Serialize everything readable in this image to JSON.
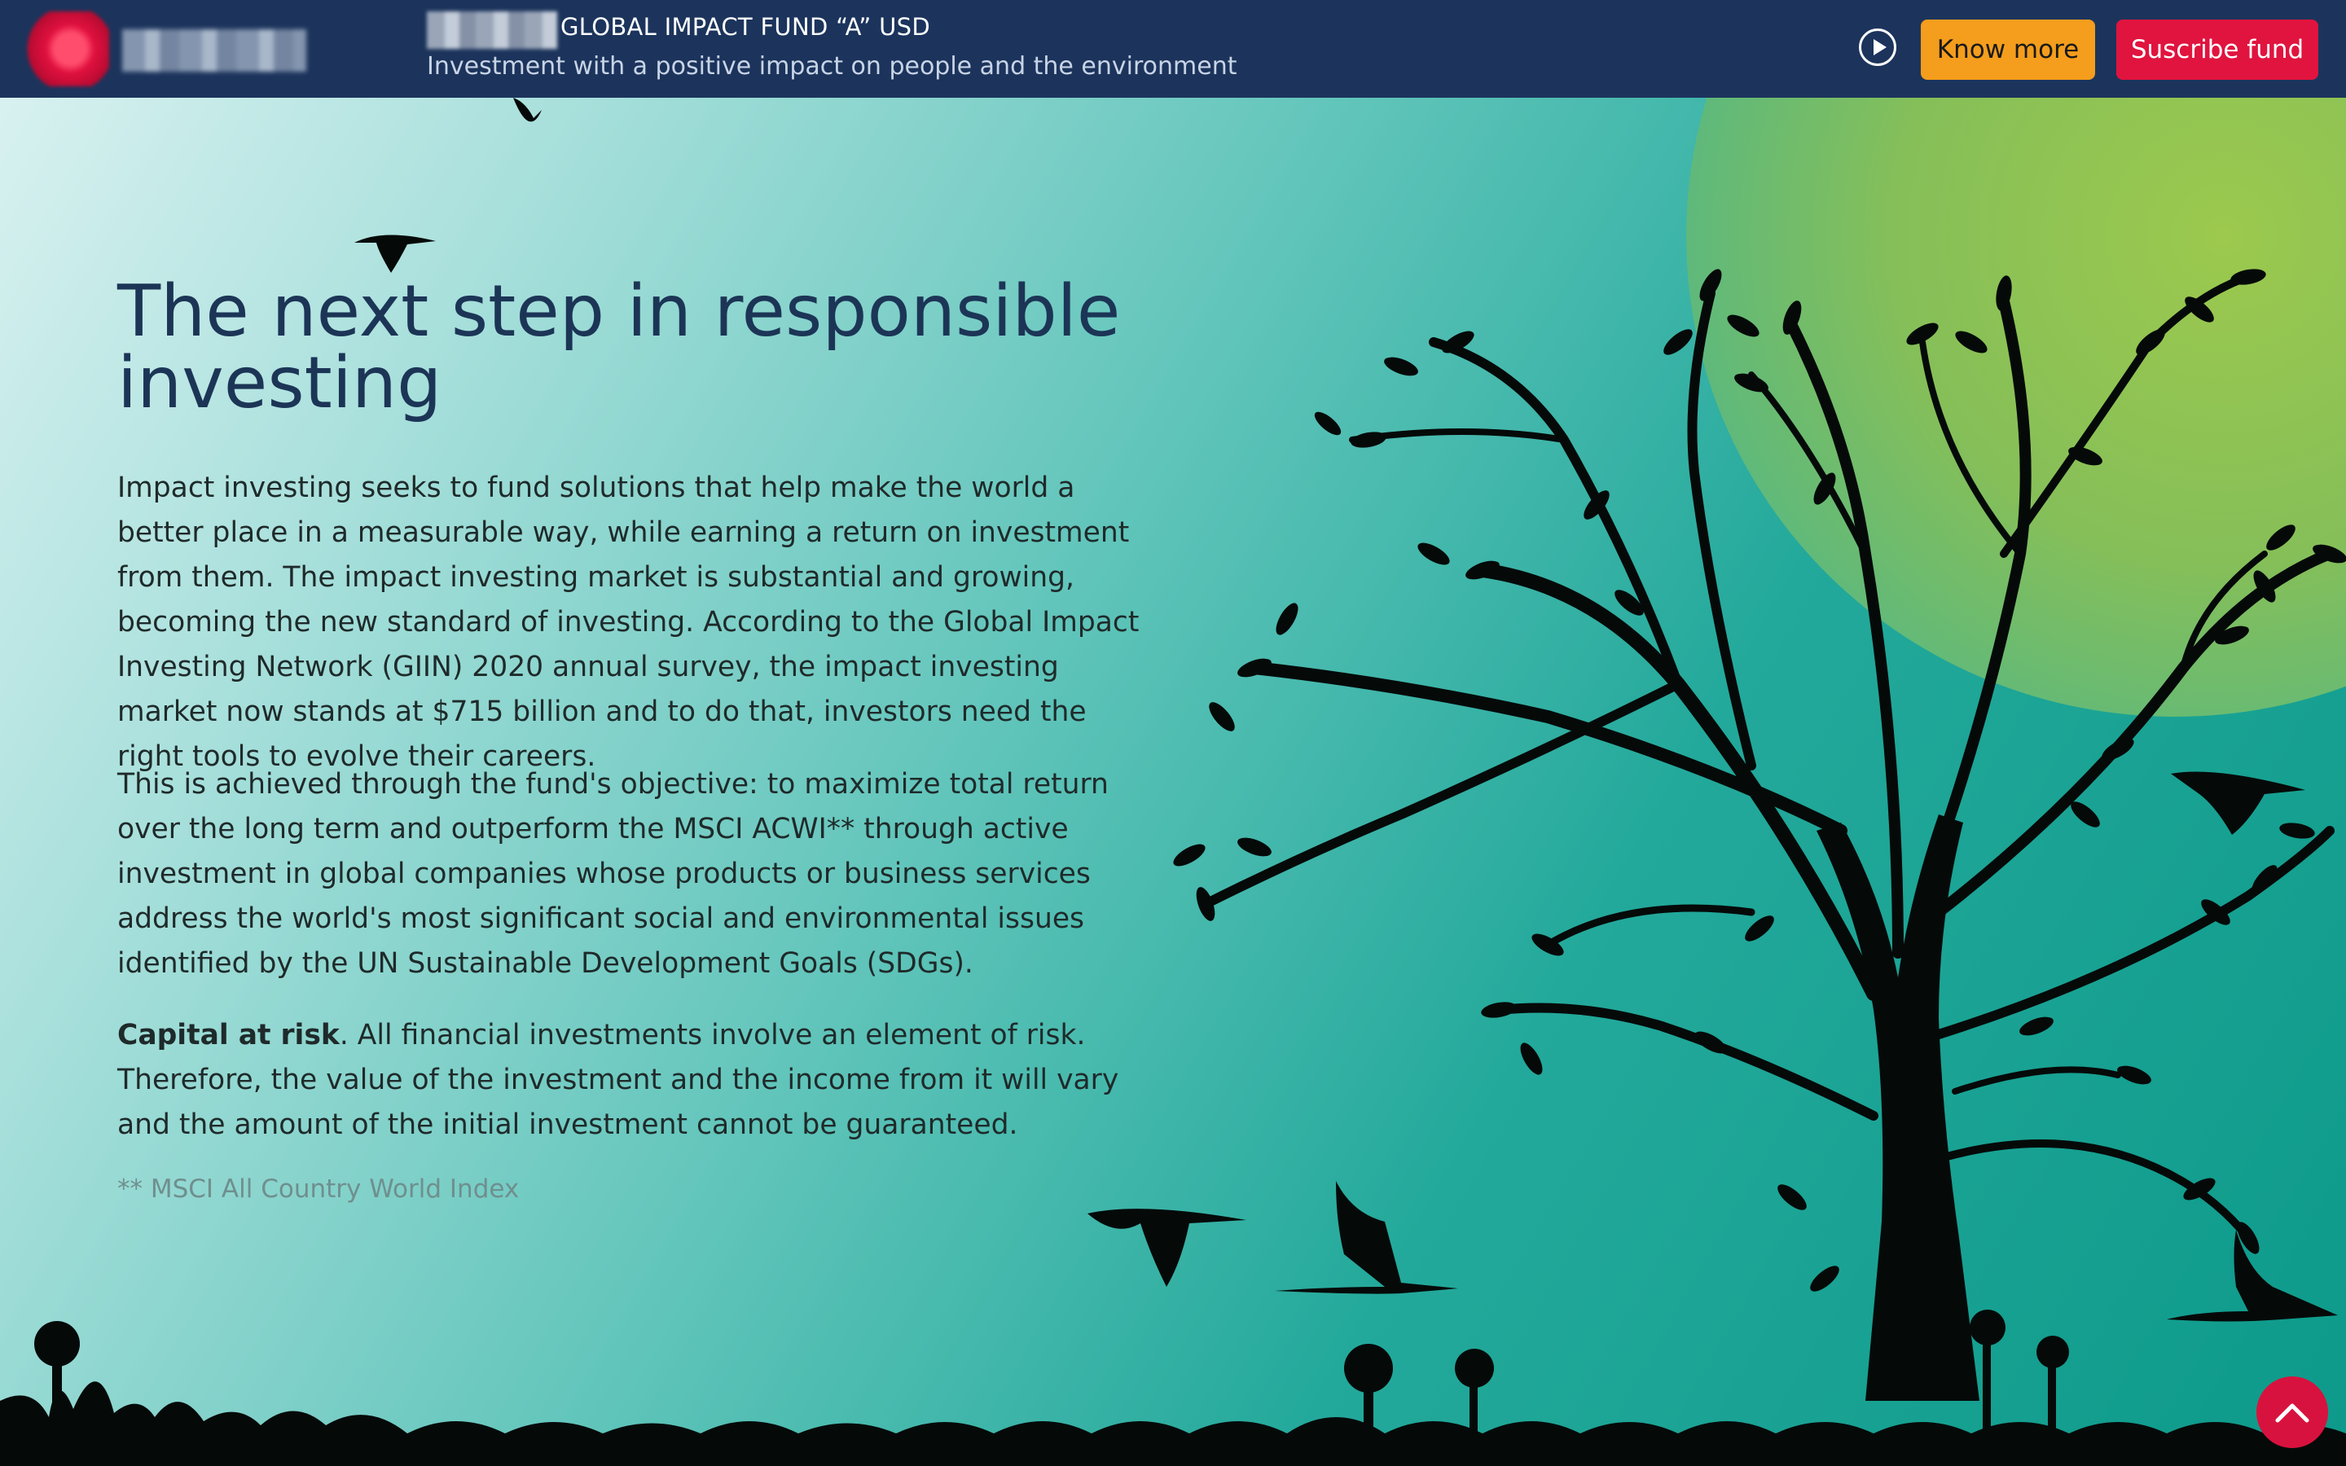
{
  "header": {
    "fund_title": "GLOBAL IMPACT FUND “A” USD",
    "fund_subtitle": "Investment with a positive impact on people and the environment",
    "know_more_label": "Know more",
    "subscribe_label": "Suscribe fund",
    "play_icon": "play-circle-icon"
  },
  "hero": {
    "headline": "The next step in responsible investing",
    "paragraph1": "Impact investing seeks to fund solutions that help make the world a better place in a measurable way, while earning a return on investment from them. The impact investing market is substantial and growing, becoming the new standard of investing. According to the Global Impact Investing Network (GIIN) 2020 annual survey, the impact investing market now stands at $715 billion and to do that, investors need the right tools to evolve their careers.",
    "paragraph2": "This is achieved through the fund's objective: to maximize total return over the long term and outperform the MSCI ACWI** through active investment in global companies whose products or business services address the world's most significant social and environmental issues identified by the UN Sustainable Development Goals (SDGs).",
    "risk_bold": "Capital at risk",
    "risk_text": ". All financial investments involve an element of risk. Therefore, the value of the investment and the income from it will vary and the amount of the initial investment cannot be guaranteed.",
    "footnote": "** MSCI All Country World Index"
  },
  "scroll_top_icon": "chevron-up-icon",
  "colors": {
    "header_bg": "#1c345c",
    "know_more_bg": "#f59d1c",
    "subscribe_bg": "#e0143f",
    "headline": "#1c3556",
    "hero_gradient_start": "#d8f1f0",
    "hero_gradient_end": "#0d9a8a"
  }
}
